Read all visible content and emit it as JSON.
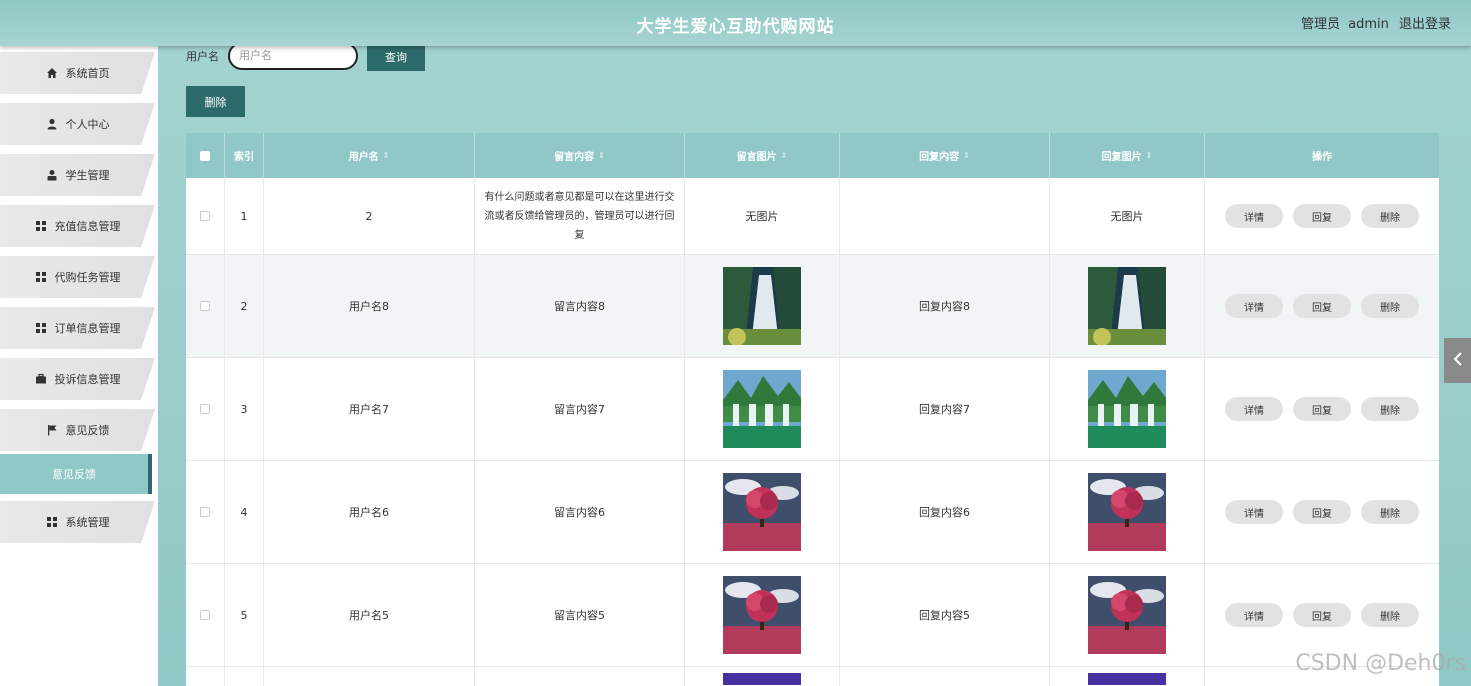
{
  "header": {
    "title": "大学生爱心互助代购网站",
    "role": "管理员",
    "username": "admin",
    "logout": "退出登录"
  },
  "sidebar": {
    "items": [
      {
        "label": "系统首页",
        "icon": "home-icon"
      },
      {
        "label": "个人中心",
        "icon": "person-icon"
      },
      {
        "label": "学生管理",
        "icon": "user-icon"
      },
      {
        "label": "充值信息管理",
        "icon": "grid-icon"
      },
      {
        "label": "代购任务管理",
        "icon": "grid-icon"
      },
      {
        "label": "订单信息管理",
        "icon": "grid-icon"
      },
      {
        "label": "投诉信息管理",
        "icon": "briefcase-icon"
      },
      {
        "label": "意见反馈",
        "icon": "flag-icon"
      },
      {
        "label": "意见反馈",
        "icon": "",
        "active": true
      },
      {
        "label": "系统管理",
        "icon": "grid-icon"
      }
    ]
  },
  "search": {
    "label": "用户名",
    "placeholder": "用户名",
    "query_button": "查询"
  },
  "toolbar": {
    "delete_label": "删除"
  },
  "table": {
    "columns": [
      "索引",
      "用户名",
      "留言内容",
      "留言图片",
      "回复内容",
      "回复图片",
      "操作"
    ],
    "rows": [
      {
        "index": "1",
        "username": "2",
        "message": "有什么问题或者意见都是可以在这里进行交流或者反馈给管理员的，管理员可以进行回复",
        "message_image": "无图片",
        "reply": "",
        "reply_image": "无图片"
      },
      {
        "index": "2",
        "username": "用户名8",
        "message": "留言内容8",
        "message_image": "waterfall",
        "reply": "回复内容8",
        "reply_image": "waterfall"
      },
      {
        "index": "3",
        "username": "用户名7",
        "message": "留言内容7",
        "message_image": "falls",
        "reply": "回复内容7",
        "reply_image": "falls"
      },
      {
        "index": "4",
        "username": "用户名6",
        "message": "留言内容6",
        "message_image": "tree",
        "reply": "回复内容6",
        "reply_image": "tree"
      },
      {
        "index": "5",
        "username": "用户名5",
        "message": "留言内容5",
        "message_image": "tree",
        "reply": "回复内容5",
        "reply_image": "tree"
      }
    ],
    "actions": [
      "详情",
      "回复",
      "删除"
    ]
  },
  "watermark": "CSDN @Deh0rs",
  "colors": {
    "header": "#8fc8c6",
    "accent_dark": "#2d6b6a",
    "sidebar_item": "#e5e5e5"
  }
}
